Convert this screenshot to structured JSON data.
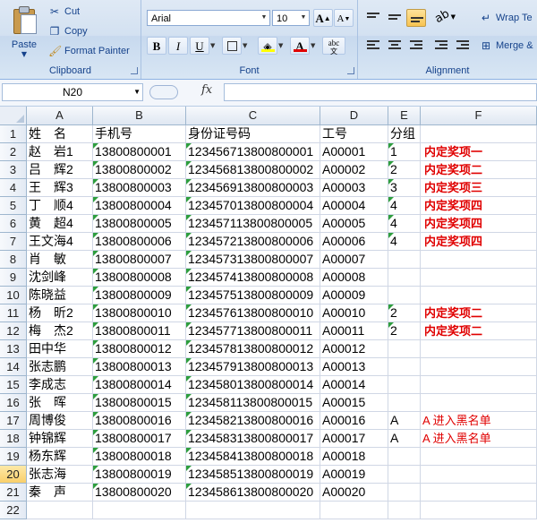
{
  "ribbon": {
    "clipboard": {
      "paste_label": "Paste",
      "cut_label": "Cut",
      "copy_label": "Copy",
      "format_painter_label": "Format Painter",
      "group_label": "Clipboard"
    },
    "font": {
      "font_name": "Arial",
      "font_size": "10",
      "grow_label": "A",
      "shrink_label": "A",
      "bold_label": "B",
      "italic_label": "I",
      "underline_label": "U",
      "font_color_label": "A",
      "phonetic_label": "abc",
      "phonetic_sub": "文",
      "group_label": "Font",
      "accent_color": "#e00000"
    },
    "alignment": {
      "wrap_text_label": "Wrap Te",
      "merge_label": "Merge &",
      "group_label": "Alignment"
    }
  },
  "formula_bar": {
    "name_box": "N20",
    "fx_label": "fx",
    "formula": ""
  },
  "sheet": {
    "columns": [
      "A",
      "B",
      "C",
      "D",
      "E",
      "F"
    ],
    "active_row": 20,
    "rows": [
      {
        "n": "1",
        "a": "姓　名",
        "b": "手机号",
        "c": "身份证号码",
        "d": "工号",
        "e": "分组",
        "f": ""
      },
      {
        "n": "2",
        "a": "赵　岩1",
        "b": "13800800001",
        "c": "123456713800800001",
        "d": "A00001",
        "e": "1",
        "f": "内定奖项一"
      },
      {
        "n": "3",
        "a": "吕　辉2",
        "b": "13800800002",
        "c": "123456813800800002",
        "d": "A00002",
        "e": "2",
        "f": "内定奖项二"
      },
      {
        "n": "4",
        "a": "王　辉3",
        "b": "13800800003",
        "c": "123456913800800003",
        "d": "A00003",
        "e": "3",
        "f": "内定奖项三"
      },
      {
        "n": "5",
        "a": "丁　顺4",
        "b": "13800800004",
        "c": "123457013800800004",
        "d": "A00004",
        "e": "4",
        "f": "内定奖项四"
      },
      {
        "n": "6",
        "a": "黄　超4",
        "b": "13800800005",
        "c": "123457113800800005",
        "d": "A00005",
        "e": "4",
        "f": "内定奖项四"
      },
      {
        "n": "7",
        "a": "王文海4",
        "b": "13800800006",
        "c": "123457213800800006",
        "d": "A00006",
        "e": "4",
        "f": "内定奖项四"
      },
      {
        "n": "8",
        "a": "肖　敏",
        "b": "13800800007",
        "c": "123457313800800007",
        "d": "A00007",
        "e": "",
        "f": ""
      },
      {
        "n": "9",
        "a": "沈剑峰",
        "b": "13800800008",
        "c": "123457413800800008",
        "d": "A00008",
        "e": "",
        "f": ""
      },
      {
        "n": "10",
        "a": "陈晓益",
        "b": "13800800009",
        "c": "123457513800800009",
        "d": "A00009",
        "e": "",
        "f": ""
      },
      {
        "n": "11",
        "a": "杨　昕2",
        "b": "13800800010",
        "c": "123457613800800010",
        "d": "A00010",
        "e": "2",
        "f": "内定奖项二"
      },
      {
        "n": "12",
        "a": "梅　杰2",
        "b": "13800800011",
        "c": "123457713800800011",
        "d": "A00011",
        "e": "2",
        "f": "内定奖项二"
      },
      {
        "n": "13",
        "a": "田中华",
        "b": "13800800012",
        "c": "123457813800800012",
        "d": "A00012",
        "e": "",
        "f": ""
      },
      {
        "n": "14",
        "a": "张志鹏",
        "b": "13800800013",
        "c": "123457913800800013",
        "d": "A00013",
        "e": "",
        "f": ""
      },
      {
        "n": "15",
        "a": "李成志",
        "b": "13800800014",
        "c": "123458013800800014",
        "d": "A00014",
        "e": "",
        "f": ""
      },
      {
        "n": "16",
        "a": "张　晖",
        "b": "13800800015",
        "c": "123458113800800015",
        "d": "A00015",
        "e": "",
        "f": ""
      },
      {
        "n": "17",
        "a": "周博俊",
        "b": "13800800016",
        "c": "123458213800800016",
        "d": "A00016",
        "e": "A",
        "f": "A 进入黑名单"
      },
      {
        "n": "18",
        "a": "钟锦辉",
        "b": "13800800017",
        "c": "123458313800800017",
        "d": "A00017",
        "e": "A",
        "f": "A 进入黑名单"
      },
      {
        "n": "19",
        "a": "杨东辉",
        "b": "13800800018",
        "c": "123458413800800018",
        "d": "A00018",
        "e": "",
        "f": ""
      },
      {
        "n": "20",
        "a": "张志海",
        "b": "13800800019",
        "c": "123458513800800019",
        "d": "A00019",
        "e": "",
        "f": ""
      },
      {
        "n": "21",
        "a": "秦　声",
        "b": "13800800020",
        "c": "123458613800800020",
        "d": "A00020",
        "e": "",
        "f": ""
      },
      {
        "n": "22",
        "a": "",
        "b": "",
        "c": "",
        "d": "",
        "e": "",
        "f": ""
      }
    ]
  }
}
